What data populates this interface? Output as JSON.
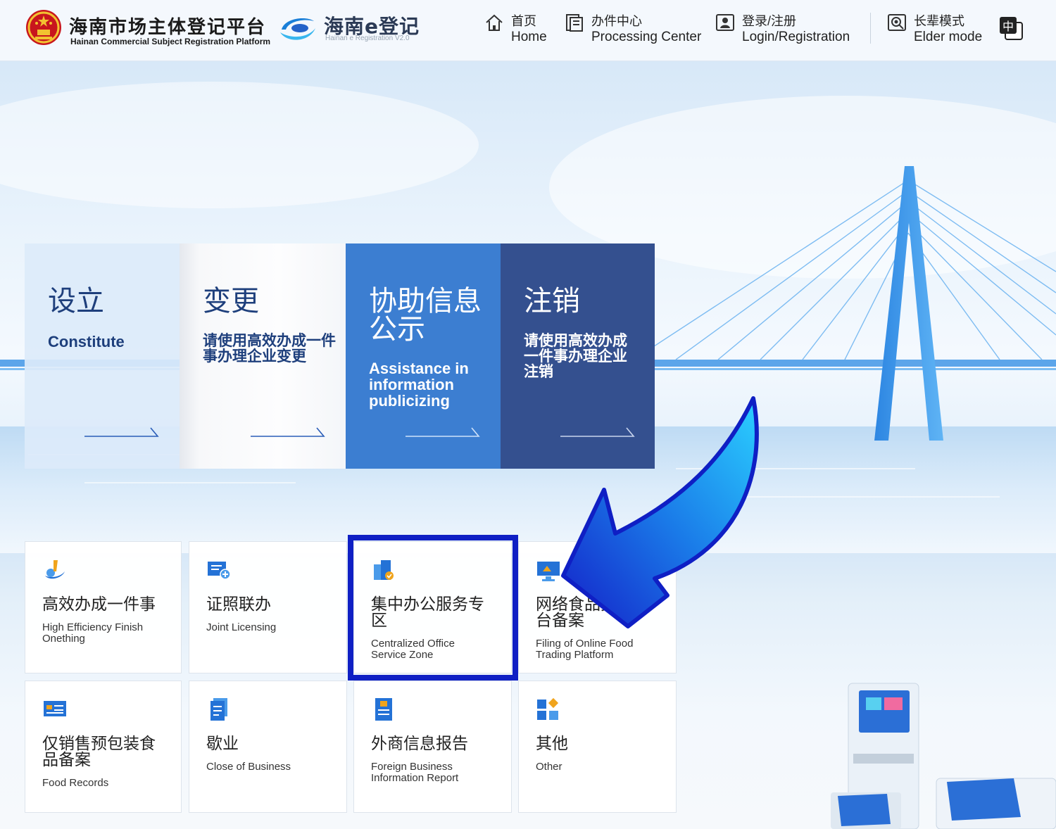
{
  "header": {
    "brand_cn": "海南市场主体登记平台",
    "brand_en": "Hainan Commercial Subject Registration Platform",
    "elogo_cn": "海南e登记",
    "elogo_en": "Hainan e Registration V2.0",
    "nav": [
      {
        "cn": "首页",
        "en": "Home",
        "icon": "home-icon"
      },
      {
        "cn": "办件中心",
        "en": "Processing Center",
        "icon": "document-icon"
      },
      {
        "cn": "登录/注册",
        "en": "Login/Registration",
        "icon": "user-card-icon"
      },
      {
        "cn": "长辈模式",
        "en": "Elder mode",
        "icon": "elder-mode-icon"
      }
    ],
    "lang_label": "中"
  },
  "tiles": [
    {
      "cn": "设立",
      "en": "Constitute"
    },
    {
      "cn": "变更",
      "en": "请使用高效办成一件事办理企业变更"
    },
    {
      "cn": "协助信息公示",
      "en": "Assistance in information publicizing"
    },
    {
      "cn": "注销",
      "en": "请使用高效办成一件事办理企业注销"
    }
  ],
  "cards": [
    {
      "cn": "高效办成一件事",
      "en": "High Efficiency Finish Onething",
      "icon": "efficiency-icon"
    },
    {
      "cn": "证照联办",
      "en": "Joint Licensing",
      "icon": "license-icon"
    },
    {
      "cn": "集中办公服务专区",
      "en": "Centralized Office Service Zone",
      "icon": "office-building-icon"
    },
    {
      "cn": "网络食品交易平台备案",
      "en": "Filing of Online Food Trading Platform",
      "icon": "monitor-icon"
    },
    {
      "cn": "仅销售预包装食品备案",
      "en": "Food Records",
      "icon": "food-record-icon"
    },
    {
      "cn": "歇业",
      "en": "Close of Business",
      "icon": "close-business-icon"
    },
    {
      "cn": "外商信息报告",
      "en": "Foreign Business Information Report",
      "icon": "report-icon"
    },
    {
      "cn": "其他",
      "en": "Other",
      "icon": "grid-icon"
    }
  ],
  "colors": {
    "highlight": "#0f1fc4",
    "tile_blue": "#3c7ed1",
    "tile_navy": "#34508f",
    "arrow": "#1a8fe8"
  }
}
